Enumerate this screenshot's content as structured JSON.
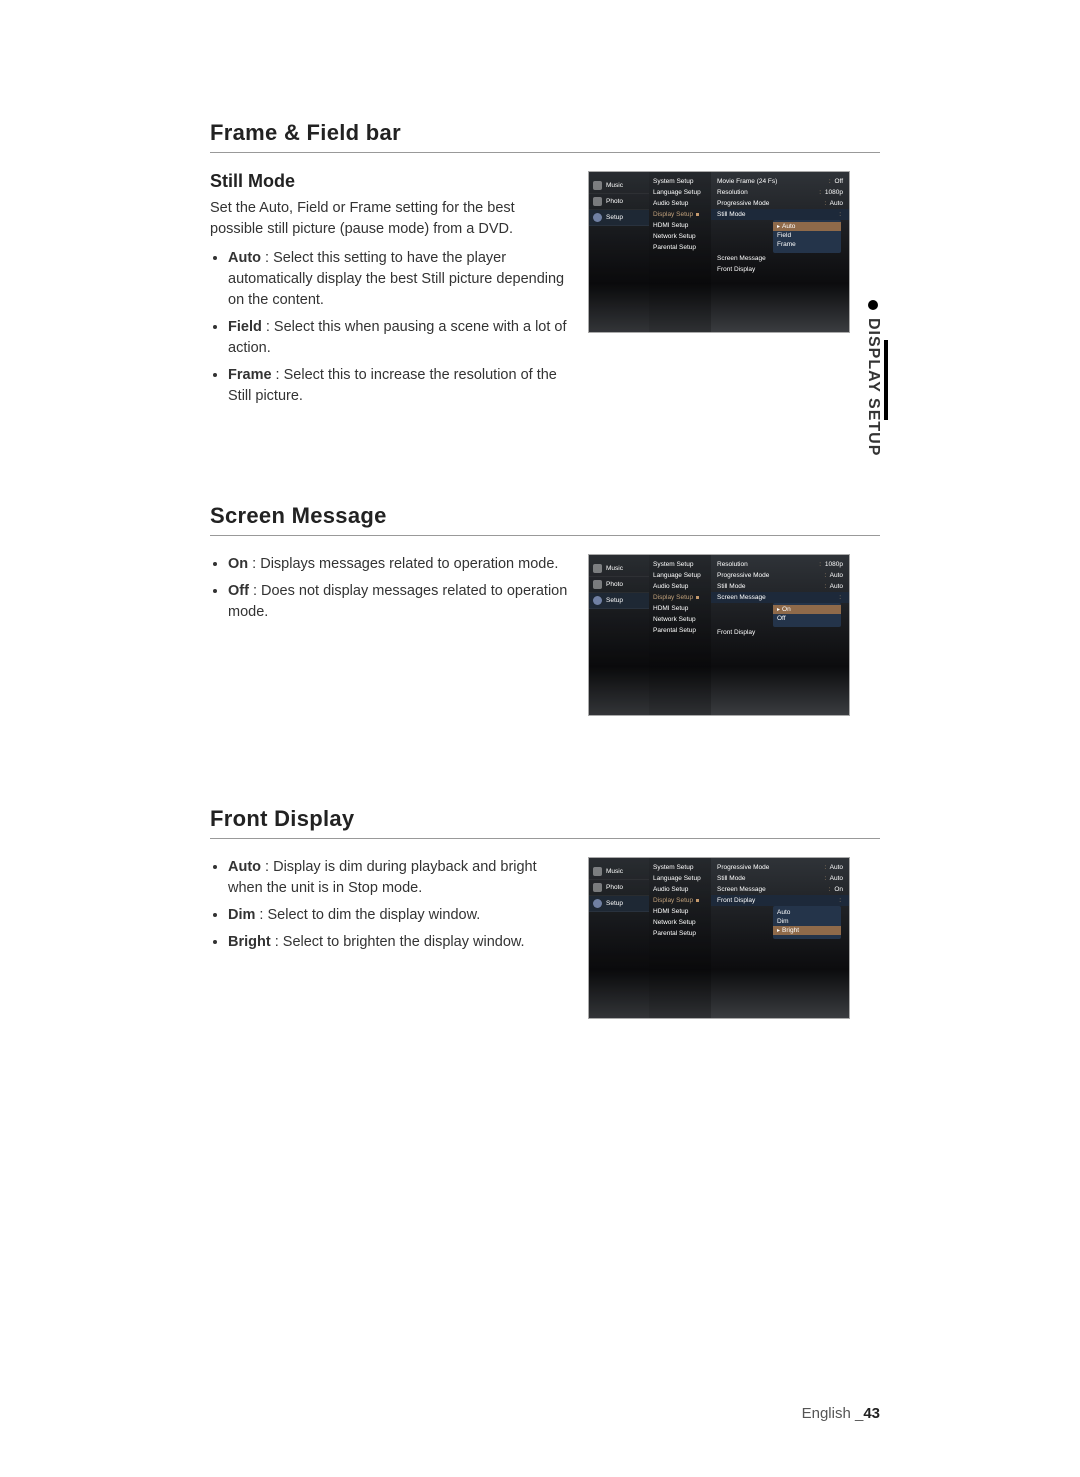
{
  "side_tab": {
    "label": "DISPLAY SETUP"
  },
  "sections": {
    "frame_field": {
      "heading": "Frame & Field bar",
      "sub_heading": "Still Mode",
      "intro": "Set the Auto, Field or Frame setting for the best possible still picture (pause mode) from a DVD.",
      "items": [
        {
          "term": "Auto",
          "desc": " : Select this setting to have the player automatically display the best Still picture depending on the content."
        },
        {
          "term": "Field",
          "desc": " : Select this when pausing a scene with a lot of action."
        },
        {
          "term": "Frame",
          "desc": " : Select this to increase the resolution of the Still picture."
        }
      ]
    },
    "screen_message": {
      "heading": "Screen Message",
      "items": [
        {
          "term": "On",
          "desc": " : Displays messages related to operation mode."
        },
        {
          "term": "Off",
          "desc": " : Does not display messages related to operation mode."
        }
      ]
    },
    "front_display": {
      "heading": "Front Display",
      "items": [
        {
          "term": "Auto",
          "desc": " : Display is dim during playback and bright when the unit is in Stop mode."
        },
        {
          "term": "Dim",
          "desc": " : Select to dim the display window."
        },
        {
          "term": "Bright",
          "desc": " : Select to brighten the display window."
        }
      ]
    }
  },
  "osd_common": {
    "side_items": [
      "Music",
      "Photo",
      "Setup"
    ],
    "menu_items": [
      "System Setup",
      "Language Setup",
      "Audio Setup",
      "Display Setup",
      "HDMI Setup",
      "Network Setup",
      "Parental Setup"
    ]
  },
  "osd1": {
    "rows": [
      {
        "label": "Movie Frame (24 Fs)",
        "value": "Off"
      },
      {
        "label": "Resolution",
        "value": "1080p"
      },
      {
        "label": "Progressive Mode",
        "value": "Auto"
      }
    ],
    "highlight_row": {
      "label": "Still Mode"
    },
    "extra_rows": [
      {
        "label": "Screen Message"
      },
      {
        "label": "Front Display"
      }
    ],
    "options": [
      "Auto",
      "Field",
      "Frame"
    ],
    "selected_option": "Auto"
  },
  "osd2": {
    "rows": [
      {
        "label": "Resolution",
        "value": "1080p"
      },
      {
        "label": "Progressive Mode",
        "value": "Auto"
      },
      {
        "label": "Still Mode",
        "value": "Auto"
      }
    ],
    "highlight_row": {
      "label": "Screen Message"
    },
    "extra_rows": [
      {
        "label": "Front Display"
      }
    ],
    "options": [
      "On",
      "Off"
    ],
    "selected_option": "On"
  },
  "osd3": {
    "rows": [
      {
        "label": "Progressive Mode",
        "value": "Auto"
      },
      {
        "label": "Still Mode",
        "value": "Auto"
      },
      {
        "label": "Screen Message",
        "value": "On"
      }
    ],
    "highlight_row": {
      "label": "Front Display"
    },
    "extra_rows": [],
    "options": [
      "Auto",
      "Dim",
      "Bright"
    ],
    "selected_option": "Bright"
  },
  "footer": {
    "lang": "English ",
    "marker": "_",
    "page": "43"
  }
}
